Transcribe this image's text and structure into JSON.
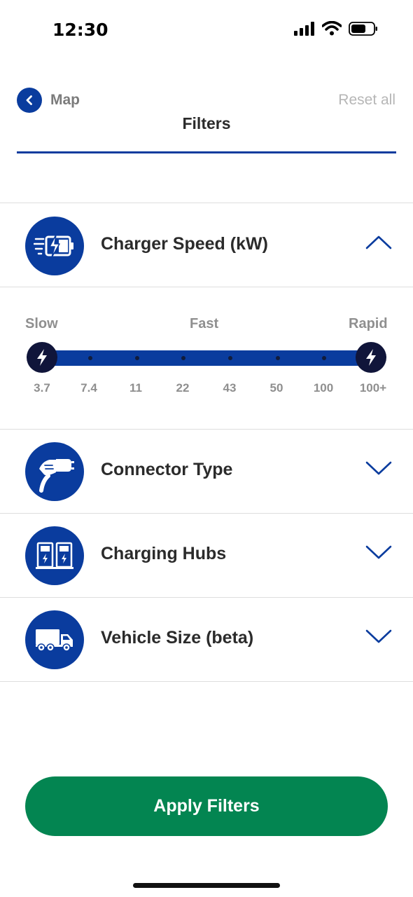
{
  "status_bar": {
    "time": "12:30",
    "icons": [
      "cellular-signal-icon",
      "wifi-icon",
      "battery-icon"
    ]
  },
  "header": {
    "back_label": "Map",
    "title": "Filters",
    "reset_label": "Reset all"
  },
  "filters": {
    "charger_speed": {
      "label": "Charger Speed (kW)",
      "icon": "fast-charging-battery-icon",
      "expanded": true,
      "categories": [
        "Slow",
        "Fast",
        "Rapid"
      ],
      "ticks": [
        "3.7",
        "7.4",
        "11",
        "22",
        "43",
        "50",
        "100",
        "100+"
      ],
      "selected_min": "3.7",
      "selected_max": "100+"
    },
    "connector_type": {
      "label": "Connector Type",
      "icon": "charging-plug-hand-icon",
      "expanded": false
    },
    "charging_hubs": {
      "label": "Charging Hubs",
      "icon": "charging-stations-icon",
      "expanded": false
    },
    "vehicle_size": {
      "label": "Vehicle Size (beta)",
      "icon": "truck-icon",
      "expanded": false
    }
  },
  "apply_label": "Apply Filters",
  "colors": {
    "brand_blue": "#0a3c9e",
    "handle_navy": "#10153a",
    "apply_green": "#038551",
    "muted_text": "#8f8f8f",
    "reset_text": "#b6b6b6"
  }
}
